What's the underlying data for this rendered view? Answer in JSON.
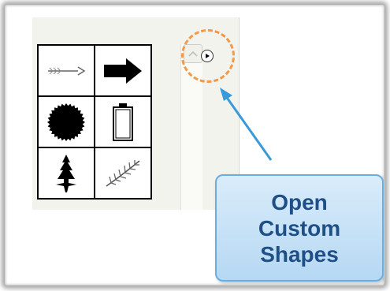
{
  "callout": {
    "line1": "Open",
    "line2": "Custom",
    "line3": "Shapes"
  },
  "shapes": [
    {
      "icon": "thin-arrow-icon"
    },
    {
      "icon": "bold-arrow-icon"
    },
    {
      "icon": "seal-burst-icon"
    },
    {
      "icon": "frame-icon"
    },
    {
      "icon": "tree-icon"
    },
    {
      "icon": "fern-leaf-icon"
    }
  ],
  "colors": {
    "highlight": "#f2994a",
    "callout_fill": "#c8e2f7",
    "callout_border": "#6aaee0",
    "callout_text": "#1f4f86",
    "pointer_arrow": "#3a9ad9"
  }
}
